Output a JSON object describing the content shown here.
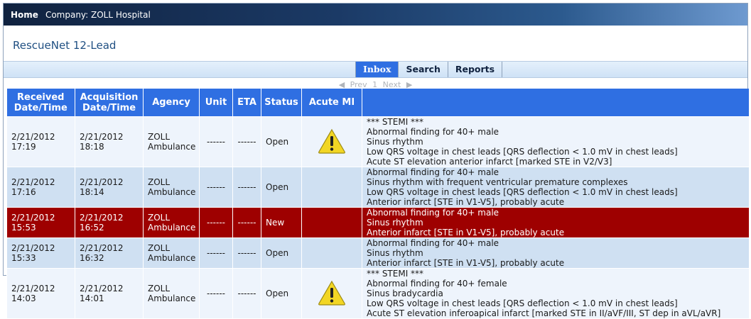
{
  "topbar": {
    "home": "Home",
    "company": "Company: ZOLL Hospital"
  },
  "app_title": "RescueNet 12-Lead",
  "tabs": [
    {
      "label": "Inbox",
      "active": true
    },
    {
      "label": "Search",
      "active": false
    },
    {
      "label": "Reports",
      "active": false
    }
  ],
  "pager": {
    "prev": "Prev",
    "page": "1",
    "next": "Next"
  },
  "columns": {
    "received": [
      "Received",
      "Date/Time"
    ],
    "acquisition": [
      "Acquisition",
      "Date/Time"
    ],
    "agency": "Agency",
    "unit": "Unit",
    "eta": "ETA",
    "status": "Status",
    "acute_mi": "Acute MI"
  },
  "rows": [
    {
      "received": [
        "2/21/2012",
        "17:19"
      ],
      "acquisition": [
        "2/21/2012",
        "18:18"
      ],
      "agency": [
        "ZOLL",
        "Ambulance"
      ],
      "unit": "------",
      "eta": "------",
      "status": "Open",
      "acute_mi": true,
      "interpretation": [
        "*** STEMI ***",
        "Abnormal finding for 40+ male",
        "Sinus rhythm",
        "Low QRS voltage in chest leads [QRS deflection < 1.0 mV in chest leads]",
        "Acute ST elevation anterior infarct [marked STE in V2/V3]"
      ]
    },
    {
      "received": [
        "2/21/2012",
        "17:16"
      ],
      "acquisition": [
        "2/21/2012",
        "18:14"
      ],
      "agency": [
        "ZOLL",
        "Ambulance"
      ],
      "unit": "------",
      "eta": "------",
      "status": "Open",
      "acute_mi": false,
      "interpretation": [
        "Abnormal finding for 40+ male",
        "Sinus rhythm with frequent ventricular premature complexes",
        "Low QRS voltage in chest leads [QRS deflection < 1.0 mV in chest leads]",
        "Anterior infarct [STE in V1-V5], probably acute"
      ]
    },
    {
      "received": [
        "2/21/2012",
        "15:53"
      ],
      "acquisition": [
        "2/21/2012",
        "16:52"
      ],
      "agency": [
        "ZOLL",
        "Ambulance"
      ],
      "unit": "------",
      "eta": "------",
      "status": "New",
      "acute_mi": false,
      "interpretation": [
        "Abnormal finding for 40+ male",
        "Sinus rhythm",
        "Anterior infarct [STE in V1-V5], probably acute"
      ]
    },
    {
      "received": [
        "2/21/2012",
        "15:33"
      ],
      "acquisition": [
        "2/21/2012",
        "16:32"
      ],
      "agency": [
        "ZOLL",
        "Ambulance"
      ],
      "unit": "------",
      "eta": "------",
      "status": "Open",
      "acute_mi": false,
      "interpretation": [
        "Abnormal finding for 40+ male",
        "Sinus rhythm",
        "Anterior infarct [STE in V1-V5], probably acute"
      ]
    },
    {
      "received": [
        "2/21/2012",
        "14:03"
      ],
      "acquisition": [
        "2/21/2012",
        "14:01"
      ],
      "agency": [
        "ZOLL",
        "Ambulance"
      ],
      "unit": "------",
      "eta": "------",
      "status": "Open",
      "acute_mi": true,
      "interpretation": [
        "*** STEMI ***",
        "Abnormal finding for 40+ female",
        "Sinus bradycardia",
        "Low QRS voltage in chest leads [QRS deflection < 1.0 mV in chest leads]",
        "Acute ST elevation inferoapical infarct [marked STE in II/aVF/III, ST dep in aVL/aVR]"
      ]
    }
  ],
  "colors": {
    "header": "#2f6fe2",
    "alert_row": "#9e0000",
    "row_light": "#eef4fc",
    "row_dark": "#cfe0f2",
    "warning": "#f2d624"
  },
  "icons": {
    "acute_mi": "warning-icon",
    "prev": "triangle-left-icon",
    "next": "triangle-right-icon"
  }
}
